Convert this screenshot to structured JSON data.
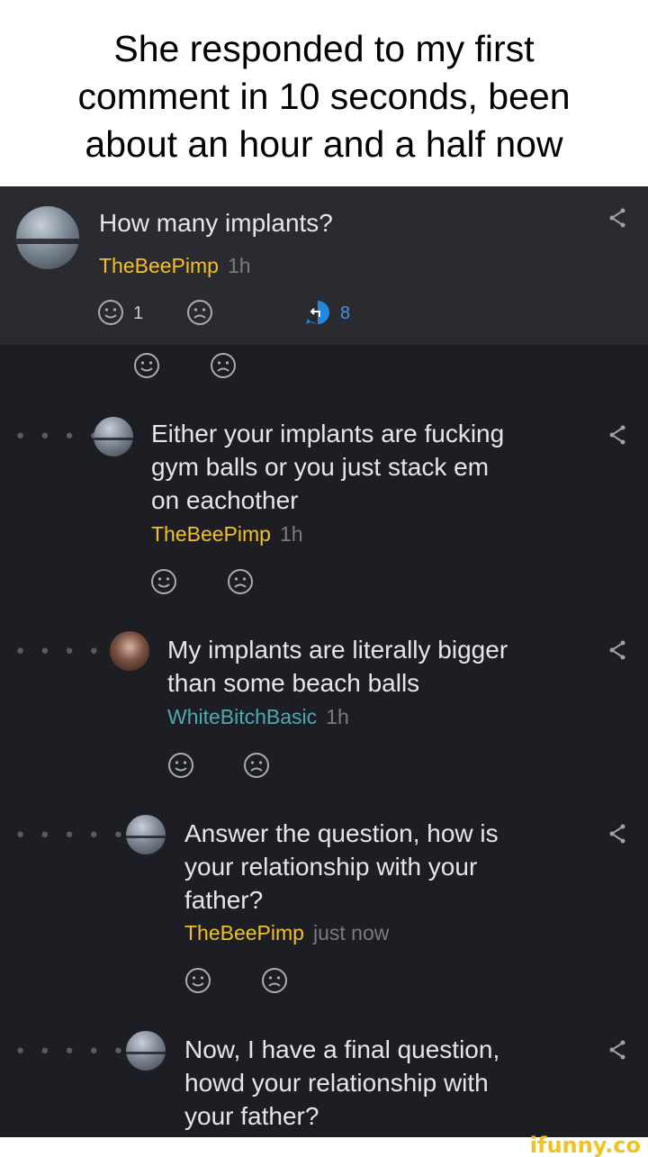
{
  "caption": {
    "line1": "She responded to my first",
    "line2": "comment in 10 seconds, been",
    "line3": "about an hour and a half now"
  },
  "post": {
    "text": "How many implants?",
    "user": "TheBeePimp",
    "time": "1h",
    "smile_count": "1",
    "reply_count": "8"
  },
  "comments": [
    {
      "lines": [
        "Either your implants are fucking",
        "gym balls or you just stack em",
        "on eachother"
      ],
      "user": "TheBeePimp",
      "time": "1h",
      "avatar": "road-avatar"
    },
    {
      "lines": [
        "My implants are literally bigger",
        "than some beach balls"
      ],
      "user": "WhiteBitchBasic",
      "time": "1h",
      "avatar": "girl-avatar"
    },
    {
      "lines": [
        "Answer the question, how is",
        "your relationship with your",
        "father?"
      ],
      "user": "TheBeePimp",
      "time": "just now",
      "avatar": "road-avatar"
    },
    {
      "lines": [
        "Now, I have a final question,",
        "howd your relationship with",
        "your father?"
      ],
      "avatar": "road-avatar"
    }
  ],
  "watermark": "ifunny.co",
  "colors": {
    "username": "#f4c21f",
    "username_alt": "#4fa9b3",
    "reply_badge": "#1e88e5",
    "background": "#1d1e23"
  }
}
